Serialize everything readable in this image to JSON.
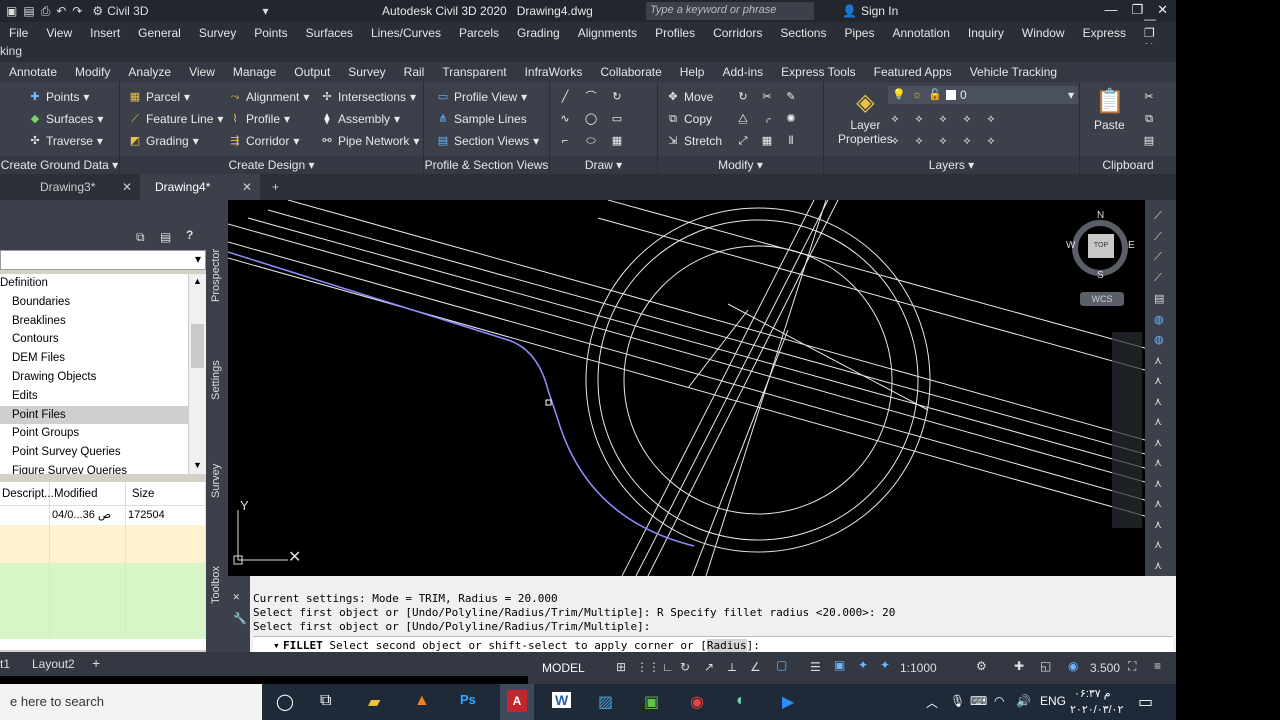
{
  "titlebar": {
    "workspace": "Civil 3D",
    "app_title": "Autodesk Civil 3D 2020",
    "doc_title": "Drawing4.dwg",
    "search_placeholder": "Type a keyword or phrase",
    "sign_in": "Sign In"
  },
  "menu": {
    "items": [
      "File",
      "View",
      "Insert",
      "General",
      "Survey",
      "Points",
      "Surfaces",
      "Lines/Curves",
      "Parcels",
      "Grading",
      "Alignments",
      "Profiles",
      "Corridors",
      "Sections",
      "Pipes",
      "Annotation",
      "Inquiry",
      "Window",
      "Express"
    ]
  },
  "strip_text": "king",
  "ribbon_tabs": [
    "Annotate",
    "Modify",
    "Analyze",
    "View",
    "Manage",
    "Output",
    "Survey",
    "Rail",
    "Transparent",
    "InfraWorks",
    "Collaborate",
    "Help",
    "Add-ins",
    "Express Tools",
    "Featured Apps",
    "Vehicle Tracking"
  ],
  "ribbon": {
    "create_ground": {
      "title": "Create Ground Data",
      "items": [
        "Points",
        "Surfaces",
        "Traverse"
      ]
    },
    "create_design": {
      "title": "Create Design",
      "items": [
        "Parcel",
        "Feature Line",
        "Grading",
        "Alignment",
        "Profile",
        "Corridor",
        "Intersections",
        "Assembly",
        "Pipe Network"
      ]
    },
    "profile_section": {
      "title": "Profile & Section Views",
      "items": [
        "Profile View",
        "Sample Lines",
        "Section Views"
      ]
    },
    "draw": {
      "title": "Draw"
    },
    "modify": {
      "title": "Modify",
      "items": [
        "Move",
        "Copy",
        "Stretch"
      ]
    },
    "layers": {
      "title": "Layers",
      "layer_properties_1": "Layer",
      "layer_properties_2": "Properties",
      "current_layer": "0"
    },
    "clipboard": {
      "title": "Clipboard",
      "paste": "Paste"
    }
  },
  "doc_tabs": [
    {
      "label": "Drawing3*"
    },
    {
      "label": "Drawing4*"
    }
  ],
  "toolspace": {
    "tree_root": "Definition",
    "tree_items": [
      "Boundaries",
      "Breaklines",
      "Contours",
      "DEM Files",
      "Drawing Objects",
      "Edits",
      "Point Files",
      "Point Groups",
      "Point Survey Queries",
      "Figure Survey Queries"
    ],
    "selected_index": 6,
    "columns": [
      "Descript...",
      "Modified",
      "Size"
    ],
    "row": {
      "desc": "",
      "modified": "04/0...36 ص",
      "size": "172504"
    },
    "side_tabs": [
      "Prospector",
      "Settings",
      "Survey",
      "Toolbox"
    ]
  },
  "viewcube": {
    "n": "N",
    "s": "S",
    "e": "E",
    "w": "W",
    "top": "TOP",
    "wcs": "WCS"
  },
  "ucs": {
    "y": "Y"
  },
  "command": {
    "history": [
      "Current settings: Mode = TRIM, Radius = 20.000",
      "Select first object or [Undo/Polyline/Radius/Trim/Multiple]: R Specify fillet radius <20.000>: 20",
      "Select first object or [Undo/Polyline/Radius/Trim/Multiple]:"
    ],
    "prompt_cmd": "FILLET",
    "prompt_text": "Select second object or shift-select to apply corner or [",
    "prompt_opt": "Radius",
    "prompt_end": "]:"
  },
  "layouts": {
    "first": "t1",
    "second": "Layout2"
  },
  "status": {
    "model": "MODEL",
    "scale": "1:1000",
    "value": "3.500"
  },
  "taskbar": {
    "search": "e here to search",
    "lang": "ENG",
    "time": "۰۶:۳۷ م",
    "date": "۲۰۲۰/۰۳/۰۲"
  },
  "colors": {
    "accent": "#3b404a",
    "dark": "#2b2f37",
    "selected_row": "#cfcfcf",
    "grid_green": "#d8f5c8"
  }
}
